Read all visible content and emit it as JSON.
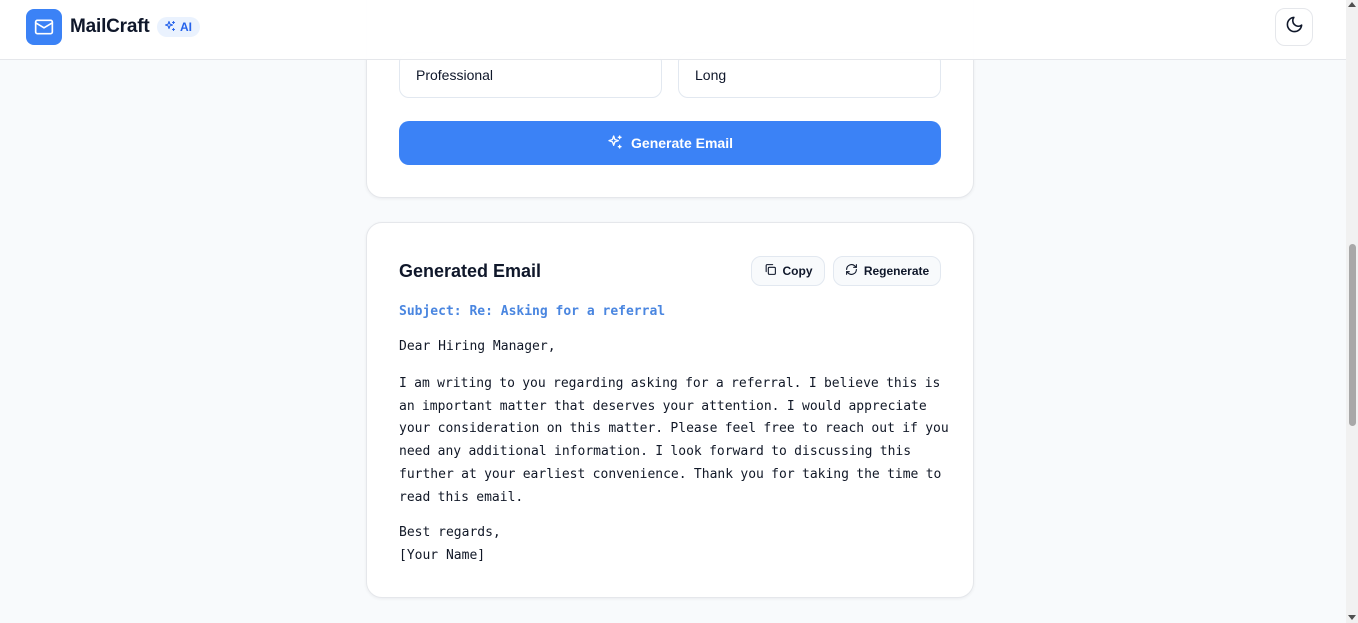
{
  "app": {
    "name": "MailCraft",
    "ai_badge": "AI"
  },
  "form": {
    "tone_value": "Professional",
    "length_value": "Long",
    "generate_label": "Generate Email"
  },
  "result": {
    "title": "Generated Email",
    "copy_label": "Copy",
    "regenerate_label": "Regenerate",
    "subject": "Subject: Re: Asking for a referral",
    "greeting": "Dear Hiring Manager,",
    "body": "I am writing to you regarding asking for a referral. I believe this is an important matter that deserves your attention. I would appreciate your consideration on this matter. Please feel free to reach out if you need any additional information. I look forward to discussing this further at your earliest convenience. Thank you for taking the time to read this email.",
    "closing": "Best regards,",
    "signature": "[Your Name]"
  },
  "colors": {
    "accent": "#3b82f6",
    "subject_text": "#4a86e0",
    "ai_badge_bg": "#eaf2fe"
  },
  "icons": {
    "logo": "mail-icon",
    "ai_badge": "sparkles-icon",
    "theme_toggle": "moon-icon",
    "generate": "sparkles-icon",
    "copy": "copy-icon",
    "regenerate": "refresh-icon"
  }
}
